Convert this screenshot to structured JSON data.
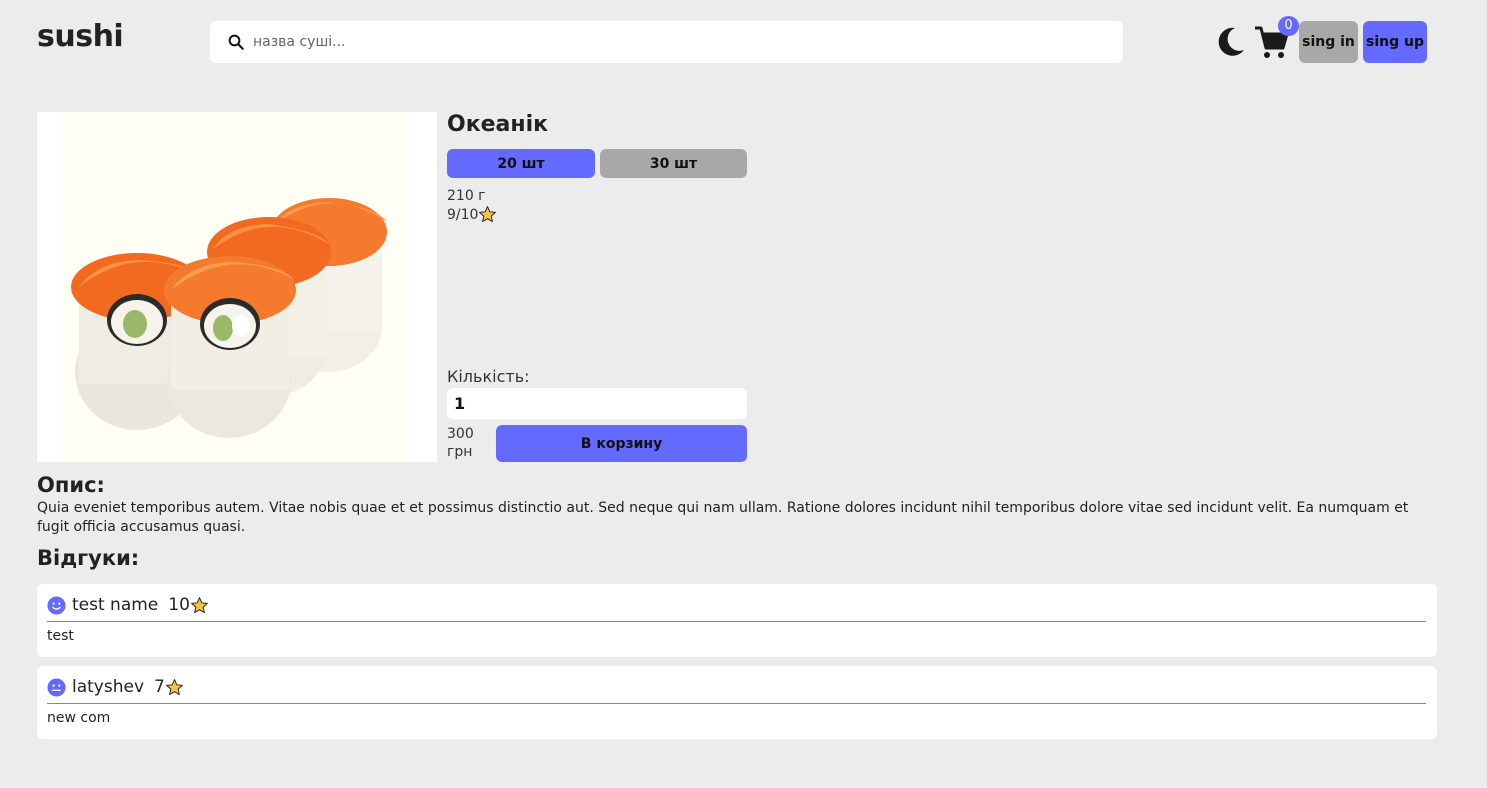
{
  "header": {
    "logo": "sushi",
    "search_placeholder": "назва суші...",
    "cart_count": "0",
    "signin_label": "sing in",
    "signup_label": "sing up"
  },
  "product": {
    "title": "Океанік",
    "sizes": [
      {
        "label": "20 шт",
        "selected": true
      },
      {
        "label": "30 шт",
        "selected": false
      }
    ],
    "weight": "210 г",
    "rating": "9/10",
    "quantity_label": "Кількість:",
    "quantity_value": "1",
    "price": "300 грн",
    "add_to_cart_label": "В корзину"
  },
  "description": {
    "title": "Опис:",
    "text": "Quia eveniet temporibus autem. Vitae nobis quae et et possimus distinctio aut. Sed neque qui nam ullam. Ratione dolores incidunt nihil temporibus dolore vitae sed incidunt velit. Ea numquam et fugit officia accusamus quasi."
  },
  "reviews": {
    "title": "Відгуки:",
    "items": [
      {
        "name": "test name",
        "score": "10",
        "text": "test",
        "face": "smile-face-icon"
      },
      {
        "name": "latyshev",
        "score": "7",
        "text": "new com",
        "face": "neutral-face-icon"
      }
    ]
  },
  "colors": {
    "accent": "#6469ff",
    "secondary": "#a8a8a8",
    "background": "#ececec",
    "star": "#f5c542"
  }
}
